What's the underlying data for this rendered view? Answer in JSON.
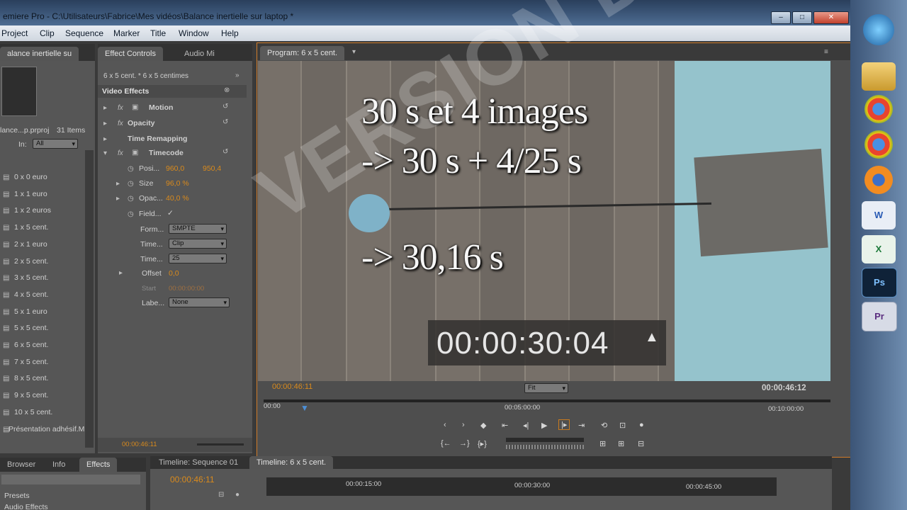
{
  "window": {
    "title": "emiere Pro - C:\\Utilisateurs\\Fabrice\\Mes vidéos\\Balance inertielle sur laptop *",
    "buttons": {
      "minimize": "–",
      "maximize": "□",
      "close": "✕"
    }
  },
  "menu": [
    "Project",
    "Clip",
    "Sequence",
    "Marker",
    "Title",
    "Window",
    "Help"
  ],
  "project_panel": {
    "tab": "alance inertielle su",
    "project_file": "lance...p.prproj",
    "items_count": "31 Items",
    "in_label": "In:",
    "in_value": "All",
    "items": [
      "0 x 0 euro",
      "1 x 1 euro",
      "1 x 2 euros",
      "1 x 5 cent.",
      "2 x 1 euro",
      "2 x 5 cent.",
      "3 x 5 cent.",
      "4 x 5 cent.",
      "5 x 1 euro",
      "5 x 5 cent.",
      "6 x 5 cent.",
      "7 x 5 cent.",
      "8 x 5 cent.",
      "9 x 5 cent.",
      "10 x 5 cent.",
      "Présentation adhésif.M"
    ]
  },
  "effect_controls": {
    "tabs": [
      "Effect Controls",
      "Audio Mi"
    ],
    "clip_path": "6 x 5 cent. * 6 x 5 centimes",
    "section": "Video Effects",
    "effects": [
      "Motion",
      "Opacity",
      "Time Remapping",
      "Timecode"
    ],
    "params": {
      "position_label": "Posi...",
      "position_x": "960,0",
      "position_y": "950,4",
      "size_label": "Size",
      "size_value": "96,0 %",
      "opacity_label": "Opac...",
      "opacity_value": "40,0 %",
      "field_label": "Field...",
      "field_check": "✓",
      "format_label": "Form...",
      "format_value": "SMPTE",
      "timecode_source_label": "Time...",
      "timecode_source_value": "Clip",
      "timebase_label": "Time...",
      "timebase_value": "25",
      "offset_label": "Offset",
      "offset_value": "0,0",
      "start_label": "Start",
      "start_value": "00:00:00:00",
      "label_label": "Labe...",
      "label_value": "None"
    },
    "footer_time": "00:00:46:11"
  },
  "program_monitor": {
    "tab": "Program: 6 x 5 cent.",
    "overlay_lines": [
      "30 s et 4 images",
      "-> 30 s + 4/25 s",
      "-> 30,16 s"
    ],
    "burned_timecode": "00:00:30:04",
    "watermark": "VERSION DÉFINITIVE",
    "current_time": "00:00:46:11",
    "zoom": "Fit",
    "duration": "00:00:46:12",
    "ruler": [
      "00:00",
      "00:05:00:00",
      "00:10:00:00"
    ]
  },
  "bottom_panels": {
    "left_tabs": [
      "Browser",
      "Info",
      "Effects"
    ],
    "presets": "Presets",
    "audio_effects": "Audio Effects",
    "timeline_tabs": [
      "Timeline: Sequence 01",
      "Timeline: 6 x 5 cent."
    ],
    "timeline_time": "00:00:46:11",
    "timeline_ruler": [
      "00:00:15:00",
      "00:00:30:00",
      "00:00:45:00"
    ]
  },
  "taskbar": {
    "apps": [
      "start-orb-icon",
      "folder-icon",
      "chrome-icon",
      "chrome-icon",
      "firefox-icon",
      "word-icon",
      "excel-icon",
      "photoshop-icon",
      "premiere-icon"
    ],
    "photoshop_label": "Ps",
    "premiere_label": "Pr"
  }
}
